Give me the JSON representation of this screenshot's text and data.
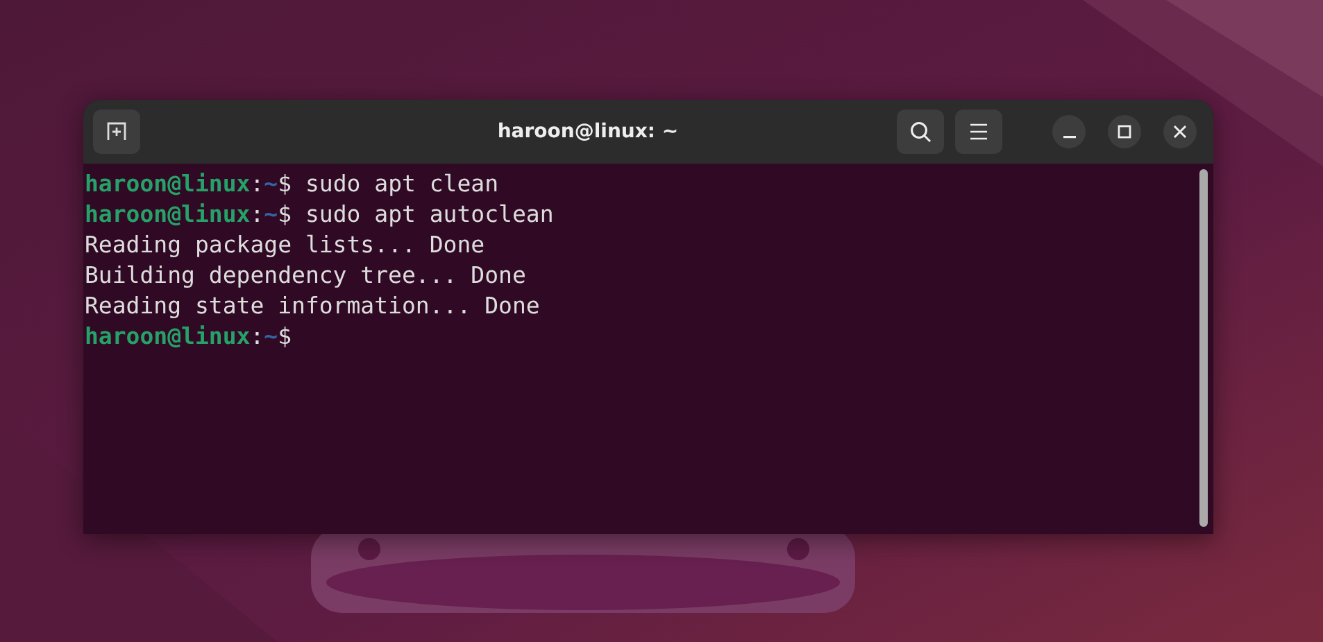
{
  "window": {
    "title": "haroon@linux: ~"
  },
  "terminal": {
    "lines": [
      {
        "kind": "prompt",
        "user": "haroon@linux",
        "separator": ":",
        "path": "~",
        "symbol": "$",
        "command": " sudo apt clean"
      },
      {
        "kind": "prompt",
        "user": "haroon@linux",
        "separator": ":",
        "path": "~",
        "symbol": "$",
        "command": " sudo apt autoclean"
      },
      {
        "kind": "output",
        "text": "Reading package lists... Done"
      },
      {
        "kind": "output",
        "text": "Building dependency tree... Done"
      },
      {
        "kind": "output",
        "text": "Reading state information... Done"
      },
      {
        "kind": "prompt",
        "user": "haroon@linux",
        "separator": ":",
        "path": "~",
        "symbol": "$"
      }
    ]
  }
}
